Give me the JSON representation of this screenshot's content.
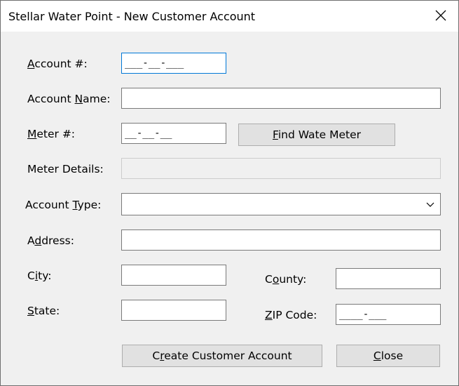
{
  "window": {
    "title": "Stellar Water Point - New Customer Account"
  },
  "form": {
    "account_number": {
      "label_pre": "",
      "label_key": "A",
      "label_post": "ccount #:",
      "value": "___-__-___"
    },
    "account_name": {
      "label_pre": "Account ",
      "label_key": "N",
      "label_post": "ame:",
      "value": ""
    },
    "meter_number": {
      "label_pre": "",
      "label_key": "M",
      "label_post": "eter #:",
      "value": "__-__-__"
    },
    "find_meter_button": {
      "label_pre": "",
      "label_key": "F",
      "label_post": "ind Wate Meter"
    },
    "meter_details": {
      "label": "Meter Details:",
      "value": ""
    },
    "account_type": {
      "label_pre": "Account ",
      "label_key": "T",
      "label_post": "ype:",
      "value": ""
    },
    "address": {
      "label_pre": "A",
      "label_key": "d",
      "label_post": "dress:",
      "value": ""
    },
    "city": {
      "label_pre": "C",
      "label_key": "i",
      "label_post": "ty:",
      "value": ""
    },
    "county": {
      "label_pre": "C",
      "label_key": "o",
      "label_post": "unty:",
      "value": ""
    },
    "state": {
      "label_pre": "",
      "label_key": "S",
      "label_post": "tate:",
      "value": ""
    },
    "zip_code": {
      "label_pre": "",
      "label_key": "Z",
      "label_post": "IP Code:",
      "value": "____-___"
    }
  },
  "actions": {
    "create_button": {
      "label_pre": "C",
      "label_key": "r",
      "label_post": "eate Customer Account"
    },
    "close_button": {
      "label_pre": "",
      "label_key": "C",
      "label_post": "lose"
    }
  },
  "icons": {
    "close": "close-icon",
    "dropdown": "chevron-down-icon"
  },
  "colors": {
    "focus_border": "#0078d7",
    "button_bg": "#e1e1e1",
    "window_bg": "#f0f0f0"
  }
}
